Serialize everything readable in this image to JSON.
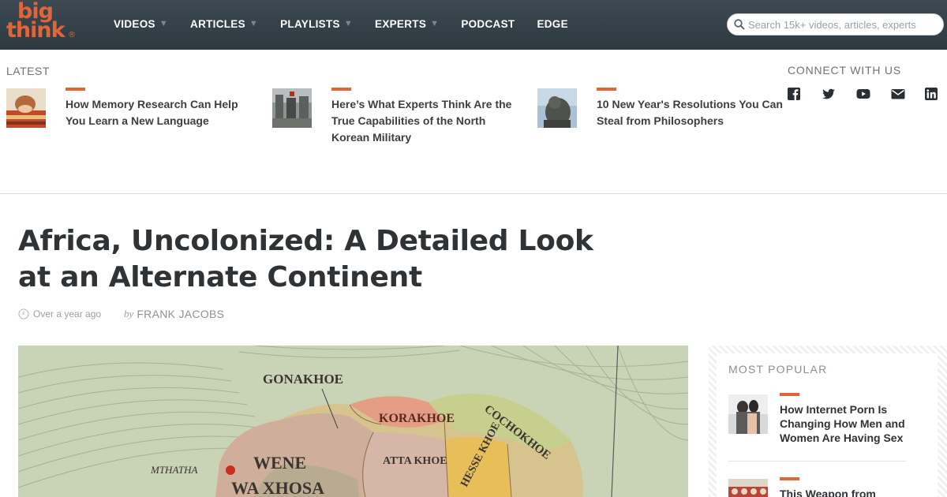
{
  "header": {
    "logo": {
      "line1": "big",
      "line2": "think",
      "mark": "®"
    },
    "nav": [
      {
        "label": "VIDEOS",
        "caret": "▼"
      },
      {
        "label": "ARTICLES",
        "caret": "▼"
      },
      {
        "label": "PLAYLISTS",
        "caret": "▼"
      },
      {
        "label": "EXPERTS",
        "caret": "▼"
      },
      {
        "label": "PODCAST",
        "caret": ""
      },
      {
        "label": "EDGE",
        "caret": ""
      }
    ],
    "search": {
      "placeholder": "Search 15k+ videos, articles, experts",
      "icon": "search-icon"
    }
  },
  "latest": {
    "label": "LATEST",
    "items": [
      {
        "title": "How Memory Research Can Help You Learn a New Language"
      },
      {
        "title": "Here’s What Experts Think Are the True Capabilities of the North Korean Military"
      },
      {
        "title": "10 New Year's Resolutions You Can Steal from Philosophers"
      }
    ]
  },
  "connect": {
    "label": "CONNECT WITH US",
    "icons": [
      "facebook-icon",
      "twitter-icon",
      "youtube-icon",
      "email-icon",
      "linkedin-icon"
    ]
  },
  "article": {
    "title": "Africa, Uncolonized: A Detailed Look at an Alternate Continent",
    "time": "Over a year ago",
    "by": "by",
    "author": "FRANK JACOBS",
    "map_labels": [
      "GONAKHOE",
      "KORAKHOE",
      "COCHOKHOE",
      "WENE",
      "WA XHOSA",
      "ATTA KHOE",
      "HESSE KHOE",
      "MTHATHA"
    ]
  },
  "sidebar": {
    "label": "MOST POPULAR",
    "items": [
      {
        "title": "How Internet Porn Is Changing How Men and Women Are Having Sex"
      },
      {
        "title": "This Weapon from"
      }
    ]
  },
  "colors": {
    "accent": "#e0663a",
    "header_bg": "#323e45"
  }
}
